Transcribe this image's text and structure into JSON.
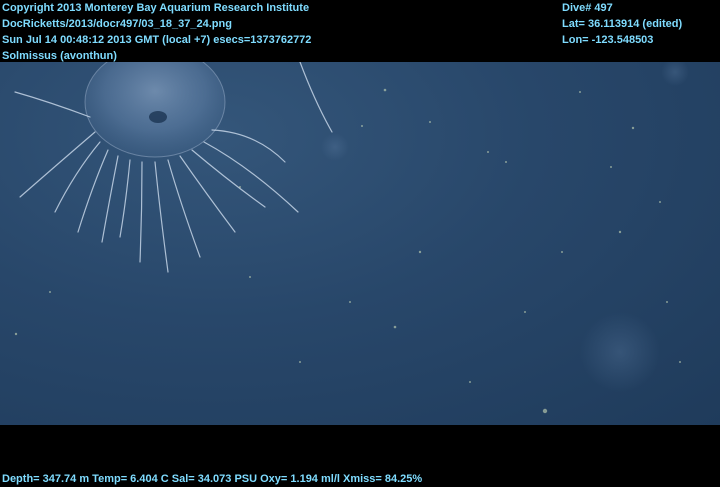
{
  "overlay_top_left": [
    "Copyright 2013 Monterey Bay Aquarium Research Institute",
    "DocRicketts/2013/docr497/03_18_37_24.png",
    "Sun Jul 14 00:48:12 2013 GMT (local +7)  esecs=1373762772",
    "Solmissus (avonthun)"
  ],
  "overlay_top_right": [
    "Dive# 497",
    "Lat= 36.113914 (edited)",
    "Lon= -123.548503"
  ],
  "overlay_bottom": "Depth= 347.74 m  Temp= 6.404 C  Sal= 34.073 PSU  Oxy= 1.194 ml/l  Xmiss= 84.25%",
  "colors": {
    "overlay_text": "#7fdcff",
    "water": "#28476a",
    "frame": "#000000"
  }
}
